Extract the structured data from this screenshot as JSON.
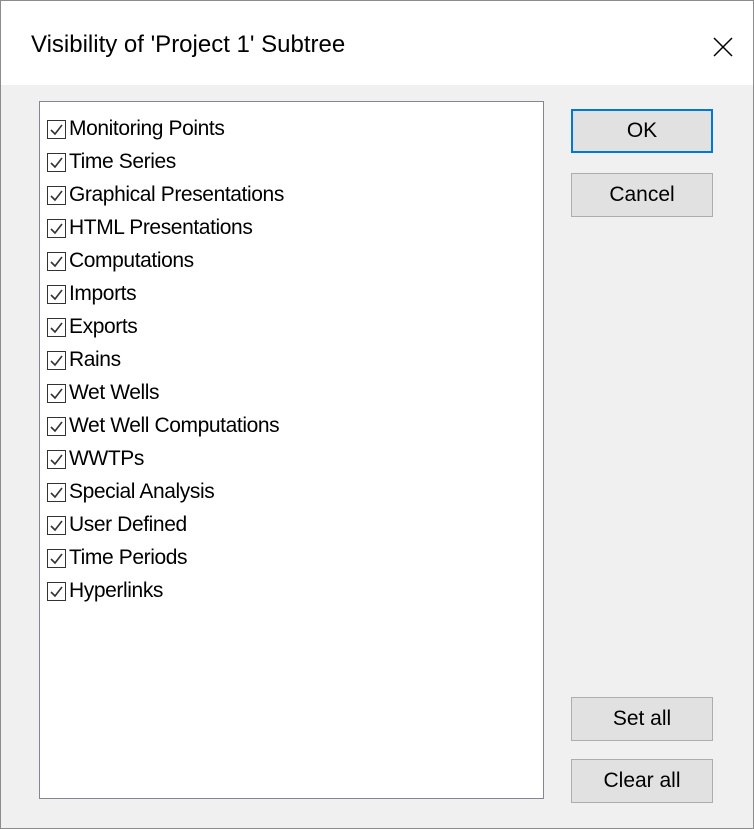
{
  "dialog": {
    "title": "Visibility of 'Project 1' Subtree",
    "close_icon": "close-icon"
  },
  "list": {
    "items": [
      {
        "label": "Monitoring Points",
        "checked": true
      },
      {
        "label": "Time Series",
        "checked": true
      },
      {
        "label": "Graphical Presentations",
        "checked": true
      },
      {
        "label": "HTML Presentations",
        "checked": true
      },
      {
        "label": "Computations",
        "checked": true
      },
      {
        "label": "Imports",
        "checked": true
      },
      {
        "label": "Exports",
        "checked": true
      },
      {
        "label": "Rains",
        "checked": true
      },
      {
        "label": "Wet Wells",
        "checked": true
      },
      {
        "label": "Wet Well Computations",
        "checked": true
      },
      {
        "label": "WWTPs",
        "checked": true
      },
      {
        "label": "Special Analysis",
        "checked": true
      },
      {
        "label": "User Defined",
        "checked": true
      },
      {
        "label": "Time Periods",
        "checked": true
      },
      {
        "label": "Hyperlinks",
        "checked": true
      }
    ]
  },
  "buttons": {
    "ok": "OK",
    "cancel": "Cancel",
    "set_all": "Set all",
    "clear_all": "Clear all"
  },
  "colors": {
    "accent": "#0078d7",
    "dialog_bg": "#f0f0f0",
    "button_bg": "#e1e1e1"
  }
}
